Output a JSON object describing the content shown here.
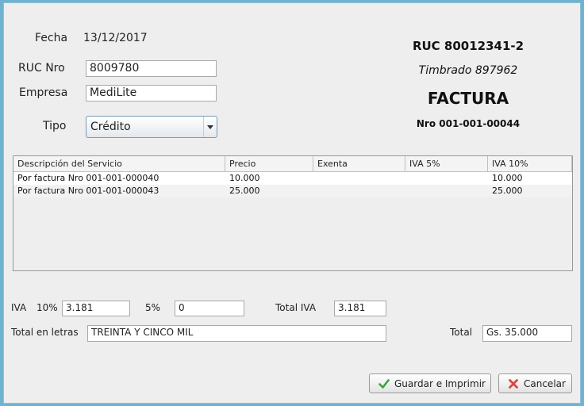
{
  "form": {
    "fecha_label": "Fecha",
    "fecha_value": "13/12/2017",
    "ruc_label": "RUC Nro",
    "ruc_value": "8009780",
    "empresa_label": "Empresa",
    "empresa_value": "MediLite",
    "tipo_label": "Tipo",
    "tipo_value": "Crédito"
  },
  "invoice": {
    "ruc": "RUC 80012341-2",
    "timbrado": "Timbrado 897962",
    "title": "FACTURA",
    "numero": "Nro 001-001-00044"
  },
  "table": {
    "columns": [
      "Descripción del Servicio",
      "Precio",
      "Exenta",
      "IVA 5%",
      "IVA 10%"
    ],
    "rows": [
      [
        "Por factura Nro 001-001-000040",
        "10.000",
        "",
        "",
        "10.000"
      ],
      [
        "Por factura Nro 001-001-000043",
        "25.000",
        "",
        "",
        "25.000"
      ]
    ]
  },
  "totals": {
    "iva_label": "IVA",
    "iva10_label": "10%",
    "iva10_value": "3.181",
    "iva5_label": "5%",
    "iva5_value": "0",
    "total_iva_label": "Total IVA",
    "total_iva_value": "3.181",
    "total_letras_label": "Total en letras",
    "total_letras_value": "TREINTA Y CINCO MIL",
    "total_label": "Total",
    "total_value": "Gs. 35.000"
  },
  "actions": {
    "save_label": "Guardar e Imprimir",
    "cancel_label": "Cancelar"
  },
  "icons": {
    "save": "check-icon",
    "cancel": "x-icon"
  },
  "colors": {
    "check": "#3aa53a",
    "cross": "#e0463c",
    "frame": "#6fb3cf"
  }
}
